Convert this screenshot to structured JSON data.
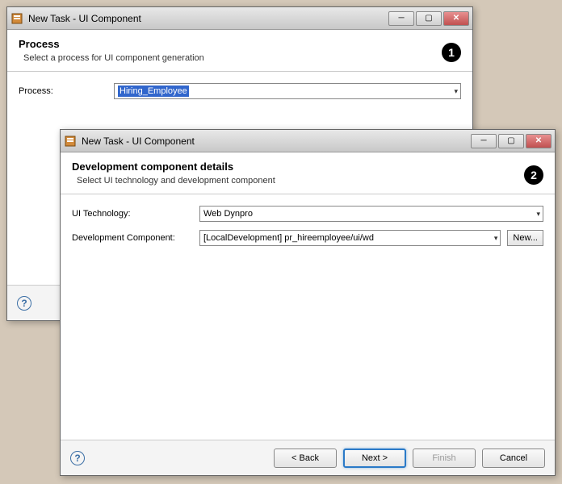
{
  "window1": {
    "title": "New Task - UI Component",
    "header": {
      "title": "Process",
      "desc": "Select a process for UI component generation"
    },
    "badge": "1",
    "form": {
      "process_label": "Process:",
      "process_value": "Hiring_Employee"
    }
  },
  "window2": {
    "title": "New Task - UI Component",
    "header": {
      "title": "Development component details",
      "desc": "Select UI technology and development component"
    },
    "badge": "2",
    "form": {
      "ui_tech_label": "UI Technology:",
      "ui_tech_value": "Web Dynpro",
      "dev_comp_label": "Development Component:",
      "dev_comp_value": "[LocalDevelopment] pr_hireemployee/ui/wd",
      "new_btn": "New..."
    },
    "footer": {
      "back": "< Back",
      "next": "Next >",
      "finish": "Finish",
      "cancel": "Cancel"
    }
  },
  "help_text": "?"
}
